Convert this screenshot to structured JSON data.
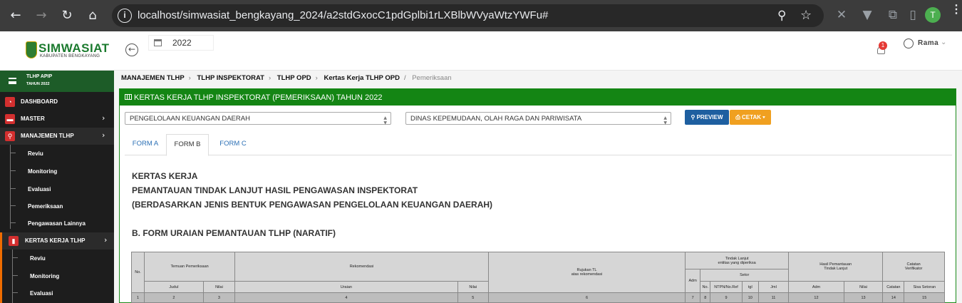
{
  "browser": {
    "url": "localhost/simwasiat_bengkayang_2024/a2stdGxocC1pdGplbi1rLXBlbWVyaWtzYWFu#",
    "profile_initial": "T"
  },
  "header": {
    "logo_text": "SIMWASIAT",
    "logo_sub": "KABUPATEN BENGKAYANG",
    "year": "2022",
    "notif_count": "1",
    "user_name": "Rama"
  },
  "sidebar": {
    "title": "TLHP APIP",
    "subtitle": "TAHUN 2022",
    "items": [
      {
        "label": "DASHBOARD",
        "icon": "dashboard-icon"
      },
      {
        "label": "MASTER",
        "icon": "folder-icon"
      },
      {
        "label": "MANAJEMEN TLHP",
        "icon": "search-icon"
      },
      {
        "label": "KERTAS KERJA TLHP",
        "icon": "file-icon"
      }
    ],
    "manajemen_sub": [
      "Reviu",
      "Monitoring",
      "Evaluasi",
      "Pemeriksaan",
      "Pengawasan Lainnya"
    ],
    "kertas_sub": [
      "Reviu",
      "Monitoring",
      "Evaluasi"
    ]
  },
  "breadcrumb": {
    "items": [
      "MANAJEMEN TLHP",
      "TLHP INSPEKTORAT",
      "TLHP OPD",
      "Kertas Kerja TLHP OPD"
    ],
    "current": "Pemeriksaan"
  },
  "panel": {
    "title": "KERTAS KERJA TLHP INSPEKTORAT (PEMERIKSAAN) TAHUN 2022",
    "select_bentuk": "PENGELOLAAN KEUANGAN DAERAH",
    "select_opd": "DINAS KEPEMUDAAN, OLAH RAGA DAN PARIWISATA",
    "preview_label": "PREVIEW",
    "cetak_label": "CETAK",
    "tabs": [
      "FORM A",
      "FORM B",
      "FORM C"
    ],
    "active_tab": "FORM B"
  },
  "document": {
    "line1": "KERTAS KERJA",
    "line2": "PEMANTAUAN TINDAK LANJUT HASIL PENGAWASAN INSPEKTORAT",
    "line3": "(BERDASARKAN JENIS BENTUK PENGAWASAN PENGELOLAAN KEUANGAN DAERAH)",
    "section": "B. FORM URAIAN PEMANTAUAN TLHP (NARATIF)"
  },
  "table": {
    "h_no": "No.",
    "h_temuan": "Temuan Pemeriksaan",
    "h_rekomendasi": "Rekomendasi",
    "h_rujukan_1": "Rujukan TL",
    "h_rujukan_2": "atas rekomendasi",
    "h_tindak_1": "Tindak Lanjut",
    "h_tindak_2": "entitas yang diperiksa",
    "h_hasil_1": "Hasil Pemantauan",
    "h_hasil_2": "Tindak Lanjut",
    "h_catatan_1": "Catatan",
    "h_catatan_2": "Verifikator",
    "h_adm": "Adm",
    "h_setor": "Setor",
    "h_judul": "Judul",
    "h_nilai": "Nilai",
    "h_uraian": "Uraian",
    "h_no2": "No.",
    "h_ntpn": "NTPN/No.Ref",
    "h_tgl": "tgl",
    "h_jml": "Jml",
    "h_adm2": "Adm",
    "h_nilai2": "Nilai",
    "h_catatan": "Catatan",
    "h_sisa": "Sisa Setoran",
    "numbers": [
      "1",
      "2",
      "3",
      "4",
      "5",
      "6",
      "7",
      "8",
      "9",
      "10",
      "11",
      "12",
      "13",
      "14",
      "15"
    ]
  }
}
